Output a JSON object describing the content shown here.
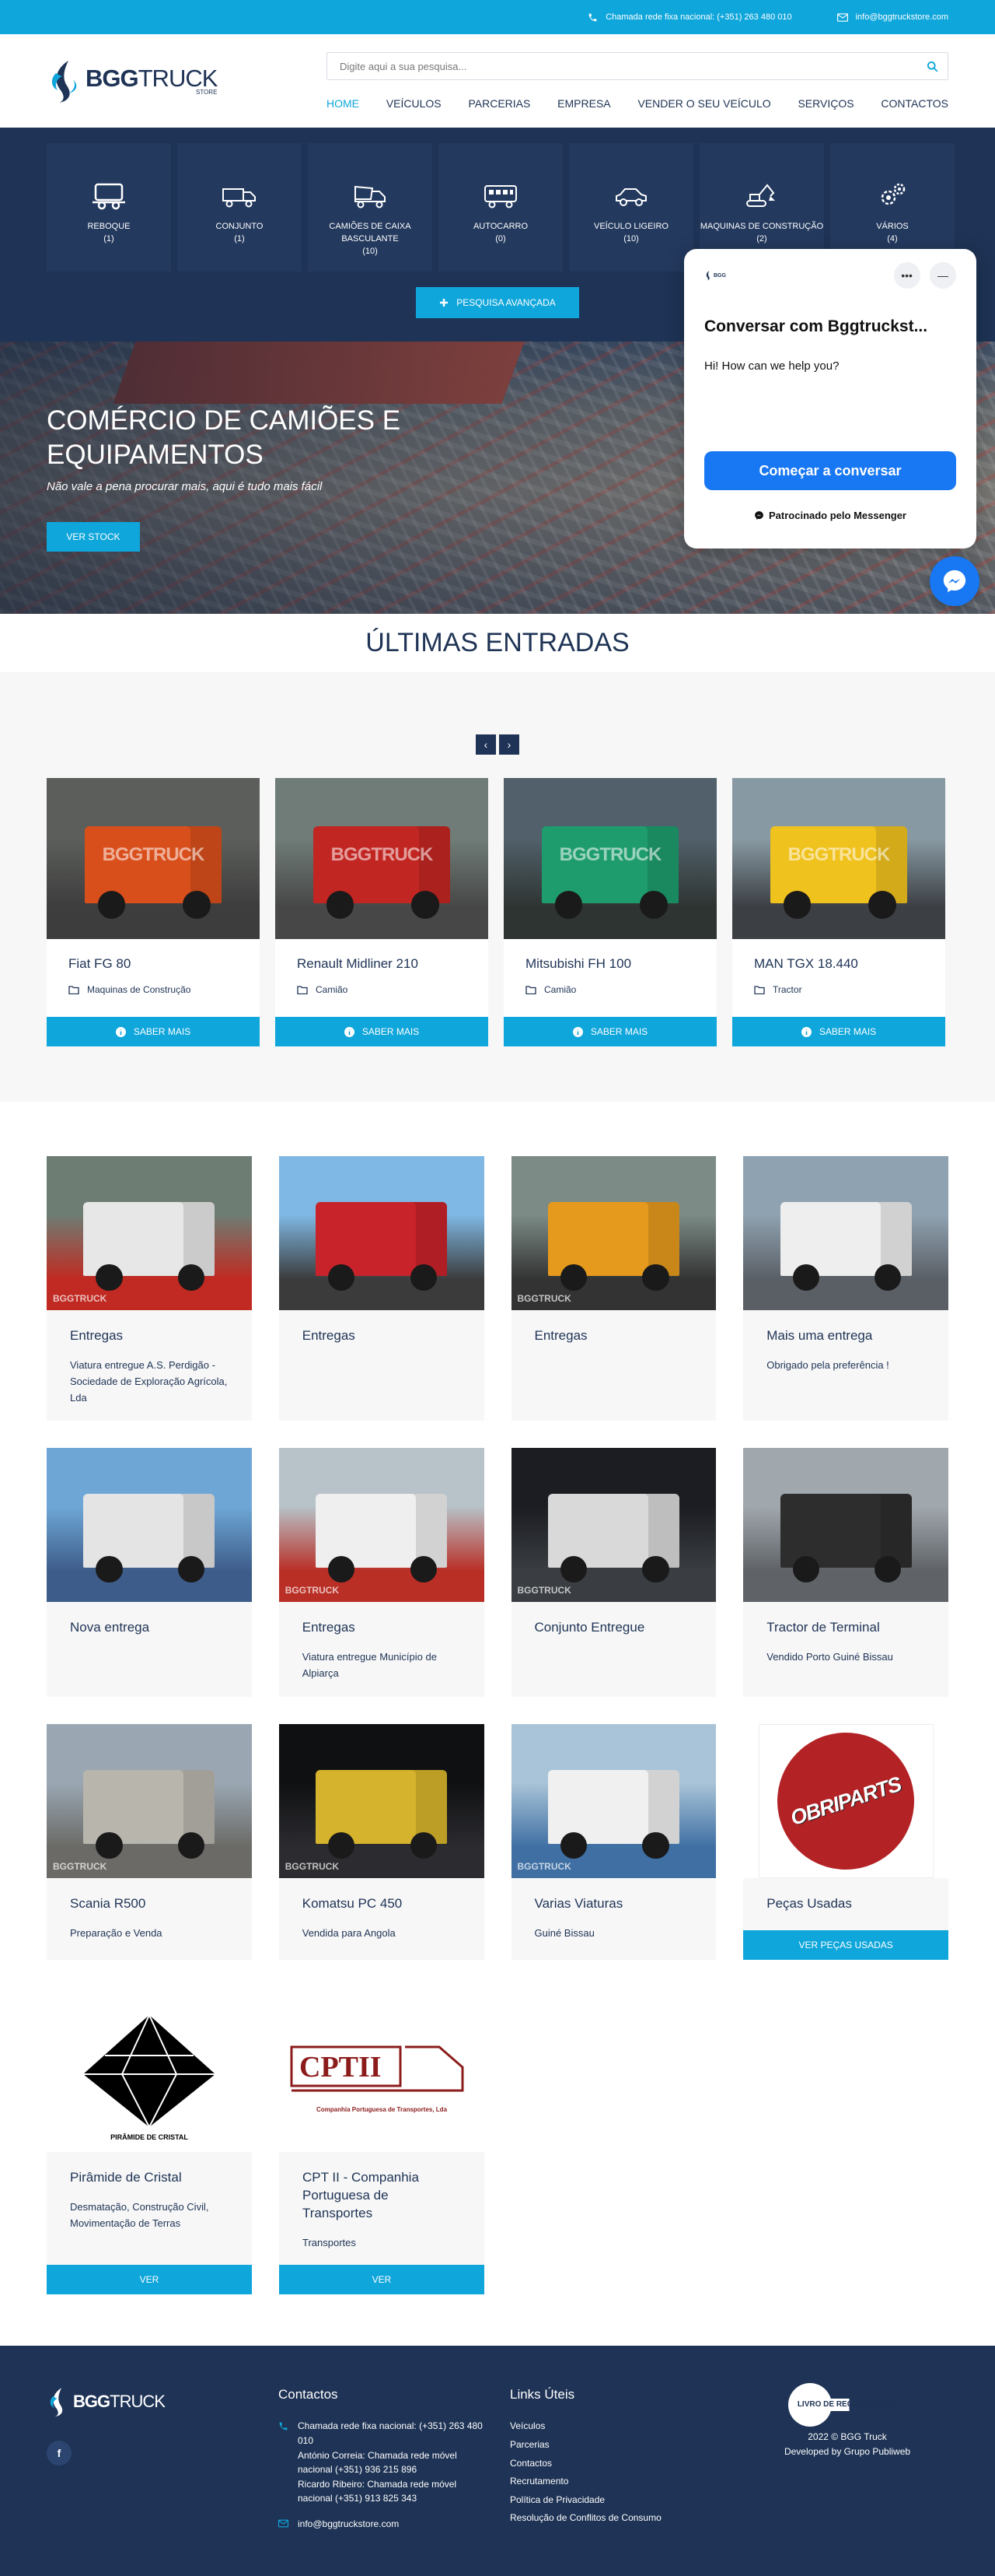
{
  "topbar": {
    "phone": "Chamada rede fixa nacional: (+351) 263 480 010",
    "email": "info@bggtruckstore.com"
  },
  "brand": {
    "name_bold": "BGG",
    "name_light": "TRUCK",
    "store": "STORE"
  },
  "search": {
    "placeholder": "Digite aqui a sua pesquisa..."
  },
  "nav": {
    "items": [
      "HOME",
      "VEÍCULOS",
      "PARCERIAS",
      "EMPRESA",
      "VENDER O SEU VEÍCULO",
      "SERVIÇOS",
      "CONTACTOS"
    ]
  },
  "categories": [
    {
      "label": "REBOQUE",
      "count": "(1)",
      "icon": "trailer-icon"
    },
    {
      "label": "CONJUNTO",
      "count": "(1)",
      "icon": "truck-trailer-icon"
    },
    {
      "label": "CAMIÕES DE CAIXA BASCULANTE",
      "count": "(10)",
      "icon": "dump-truck-icon"
    },
    {
      "label": "AUTOCARRO",
      "count": "(0)",
      "icon": "bus-icon"
    },
    {
      "label": "VEÍCULO LIGEIRO",
      "count": "(10)",
      "icon": "car-icon"
    },
    {
      "label": "MAQUINAS DE CONSTRUÇÃO",
      "count": "(2)",
      "icon": "excavator-icon"
    },
    {
      "label": "VÁRIOS",
      "count": "(4)",
      "icon": "gears-icon"
    }
  ],
  "advanced_search": "PESQUISA AVANÇADA",
  "hero": {
    "title": "COMÉRCIO DE CAMIÕES E EQUIPAMENTOS",
    "subtitle": "Não vale a pena procurar mais, aqui é tudo mais fácil",
    "button": "VER STOCK"
  },
  "latest": {
    "title": "ÚLTIMAS ENTRADAS",
    "prev": "‹",
    "next": "›",
    "button": "SABER MAIS",
    "watermark": "BGGTRUCK",
    "items": [
      {
        "title": "Fiat FG 80",
        "category": "Maquinas de Construção",
        "colors": [
          "#5b5e5a",
          "#d94f1c",
          "#3d3d3d"
        ]
      },
      {
        "title": "Renault Midliner 210",
        "category": "Camião",
        "colors": [
          "#6f7c78",
          "#c22622",
          "#474747"
        ]
      },
      {
        "title": "Mitsubishi FH 100",
        "category": "Camião",
        "colors": [
          "#51606a",
          "#1f9c6e",
          "#2e3432"
        ]
      },
      {
        "title": "MAN TGX 18.440",
        "category": "Tractor",
        "colors": [
          "#8799a2",
          "#f0c21e",
          "#3c3f44"
        ]
      }
    ]
  },
  "news": [
    {
      "title": "Entregas",
      "desc": "Viatura entregue A.S. Perdigão - Sociedade de Exploração Agrícola, Lda",
      "colors": [
        "#6e7d74",
        "#e7e7e7",
        "#c02a22"
      ]
    },
    {
      "title": "Entregas",
      "desc": "",
      "colors": [
        "#7fb8e4",
        "#c8232b",
        "#3b3b3b"
      ]
    },
    {
      "title": "Entregas",
      "desc": "",
      "colors": [
        "#7c8b85",
        "#e59a1d",
        "#333333"
      ]
    },
    {
      "title": "Mais uma entrega",
      "desc": "Obrigado pela preferência !",
      "colors": [
        "#8fa2b1",
        "#eeeeee",
        "#5a5f66"
      ]
    },
    {
      "title": "Nova entrega",
      "desc": "",
      "colors": [
        "#6ea7d6",
        "#e4e4e4",
        "#3e5c8a"
      ]
    },
    {
      "title": "Entregas",
      "desc": "Viatura entregue Município de Alpiarça",
      "colors": [
        "#b7c2c9",
        "#efefef",
        "#b92f26"
      ]
    },
    {
      "title": "Conjunto Entregue",
      "desc": "",
      "colors": [
        "#1b1d22",
        "#d9d9d9",
        "#3a3d42"
      ]
    },
    {
      "title": "Tractor de Terminal",
      "desc": "Vendido Porto Guiné Bissau",
      "colors": [
        "#a0a7ad",
        "#2d2d2d",
        "#5f6368"
      ]
    },
    {
      "title": "Scania R500",
      "desc": "Preparação e Venda",
      "colors": [
        "#9aa7b3",
        "#b8b5ad",
        "#6b6a66"
      ]
    },
    {
      "title": "Komatsu PC 450",
      "desc": "Vendida para Angola",
      "colors": [
        "#0f1012",
        "#d6b32c",
        "#2c2c30"
      ]
    },
    {
      "title": "Varias Viaturas",
      "desc": "Guiné Bissau",
      "colors": [
        "#a9c4d8",
        "#f0f0f0",
        "#3f6fa3"
      ]
    },
    {
      "title": "Peças Usadas",
      "desc": "",
      "button": "VER PEÇAS USADAS",
      "logo_text": "OBRIPARTS",
      "colors": [
        "#ffffff",
        "#b32225",
        "#ffffff"
      ]
    },
    {
      "title": "Pirâmide de Cristal",
      "desc": "Desmatação, Construção Civil, Movimentação de Terras",
      "button": "VER",
      "logo_text": "PIRÂMIDE DE CRISTAL",
      "colors": [
        "#ffffff",
        "#000000",
        "#f0a500"
      ]
    },
    {
      "title": "CPT II - Companhia Portuguesa de Transportes",
      "desc": "Transportes",
      "button": "VER",
      "logo_text": "CPTII",
      "logo_sub": "Companhia Portuguesa de Transportes, Lda",
      "colors": [
        "#ffffff",
        "#8c1c1c",
        "#8c1c1c"
      ]
    }
  ],
  "footer": {
    "contacts_title": "Contactos",
    "phone_lines": [
      "Chamada rede fixa nacional: (+351) 263 480 010",
      "António Correia: Chamada rede móvel nacional (+351) 936 215 896",
      "Ricardo Ribeiro: Chamada rede móvel nacional (+351) 913 825 343"
    ],
    "email": "info@bggtruckstore.com",
    "links_title": "Links Úteis",
    "links": [
      "Veículos",
      "Parcerias",
      "Contactos",
      "Recrutamento",
      "Política de Privacidade",
      "Resolução de Conflitos de Consumo"
    ],
    "badge": "LIVRO DE RECLAMAÇÕES",
    "copyright": "2022 © BGG Truck",
    "developer": "Developed by Grupo Publiweb"
  },
  "chat": {
    "title": "Conversar com Bggtruckst...",
    "message": "Hi! How can we help you?",
    "button": "Começar a conversar",
    "powered": "Patrocinado pelo Messenger",
    "more": "•••",
    "minimize": "—"
  },
  "colors": {
    "accent": "#0fa6db",
    "navy": "#1e3355",
    "messenger": "#1877f2"
  }
}
